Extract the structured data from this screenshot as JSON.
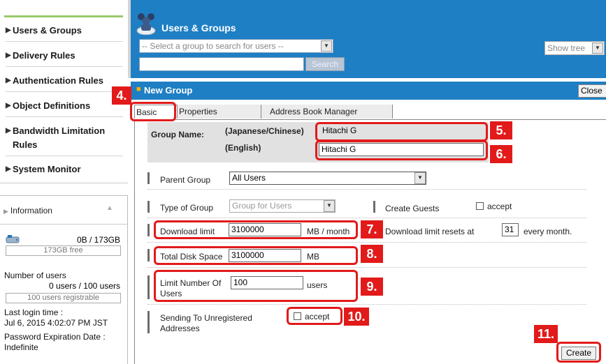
{
  "sidebar": {
    "items": [
      {
        "label": "Users & Groups"
      },
      {
        "label": "Delivery Rules"
      },
      {
        "label": "Authentication Rules"
      },
      {
        "label": "Object Definitions"
      },
      {
        "label": "Bandwidth Limitation Rules"
      },
      {
        "label": "System Monitor"
      }
    ],
    "info": {
      "header": "Information",
      "disk_usage": "0B /  173GB",
      "disk_free": "173GB free",
      "users_label": "Number of users",
      "users_value": "0 users / 100 users",
      "users_registrable": "100 users registrable",
      "last_login_label": "Last login time :",
      "last_login_value": "Jul 6, 2015 4:02:07 PM JST",
      "pwd_exp_label": "Password Expiration Date :",
      "pwd_exp_value": "Indefinite"
    }
  },
  "header": {
    "title": "Users & Groups",
    "group_select_placeholder": "-- Select a group to search for users --",
    "search_button": "Search",
    "show_tree": "Show tree"
  },
  "dialog": {
    "title": "New Group",
    "close": "Close",
    "tabs": [
      {
        "label": "Basic"
      },
      {
        "label": "Properties"
      },
      {
        "label": "Address Book Manager"
      }
    ]
  },
  "form": {
    "group_name_label": "Group Name:",
    "jp_label": "(Japanese/Chinese)",
    "en_label": "(English)",
    "jp_value": "Hitachi G",
    "en_value": "Hitachi G",
    "parent_group_label": "Parent Group",
    "parent_group_value": "All Users",
    "type_label": "Type of Group",
    "type_value": "Group for Users",
    "create_guests_label": "Create Guests",
    "accept": "accept",
    "download_label": "Download limit",
    "download_value": "3100000",
    "download_unit": "MB / month",
    "download_reset_label": "Download limit resets at",
    "download_reset_value": "31",
    "download_reset_suffix": "every month.",
    "disk_label": "Total Disk Space",
    "disk_value": "3100000",
    "disk_unit": "MB",
    "limit_users_label": "Limit Number Of Users",
    "limit_users_value": "100",
    "limit_users_unit": "users",
    "sending_label": "Sending To Unregistered Addresses",
    "create_button": "Create"
  },
  "callouts": [
    "4.",
    "5.",
    "6.",
    "7.",
    "8.",
    "9.",
    "10.",
    "11."
  ],
  "colors": {
    "accent": "#1f7fc4",
    "callout": "#e21a1a"
  }
}
